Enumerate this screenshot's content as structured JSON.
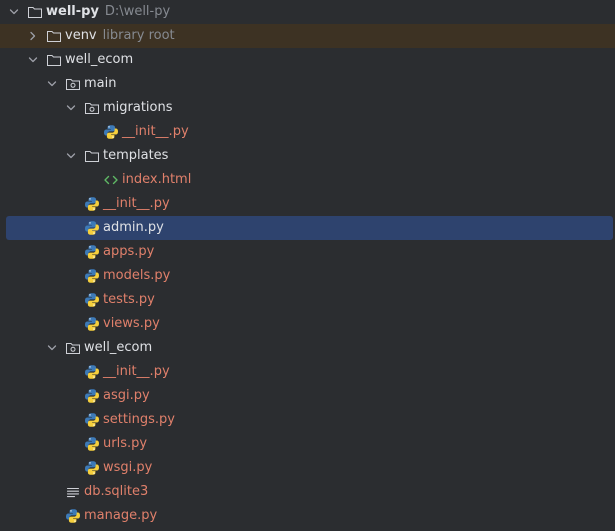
{
  "project": {
    "name": "well-py",
    "path": "D:\\well-py"
  },
  "venv": {
    "name": "venv",
    "hint": "library root"
  },
  "tree": {
    "well_ecom_root": "well_ecom",
    "main": "main",
    "migrations": "migrations",
    "migrations_init": "__init__.py",
    "templates": "templates",
    "index_html": "index.html",
    "main_init": "__init__.py",
    "admin": "admin.py",
    "apps": "apps.py",
    "models": "models.py",
    "tests": "tests.py",
    "views": "views.py",
    "well_ecom_pkg": "well_ecom",
    "pkg_init": "__init__.py",
    "asgi": "asgi.py",
    "settings": "settings.py",
    "urls": "urls.py",
    "wsgi": "wsgi.py",
    "db": "db.sqlite3",
    "manage": "manage.py"
  },
  "colors": {
    "background": "#2b2d30",
    "selection": "#2e436e",
    "venv_highlight": "#3d3223",
    "python_file_text": "#e0806b",
    "hint_text": "#868a91",
    "html_icon": "#5fb865"
  },
  "icons": {
    "chevron_expanded": "chevron-down-icon",
    "chevron_collapsed": "chevron-right-icon",
    "folder": "folder-icon",
    "package": "package-folder-icon",
    "python": "python-file-icon",
    "html": "html-file-icon",
    "text": "text-file-icon"
  }
}
